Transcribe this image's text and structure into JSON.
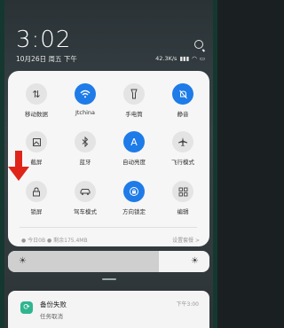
{
  "status_bar": {
    "time": "3:02",
    "date": "10月26日 周五 下午",
    "net_speed": "42.3K/s",
    "battery_icon": "battery-icon"
  },
  "tiles": [
    {
      "label": "移动数据",
      "icon": "⇅",
      "active": false
    },
    {
      "label": "Jtchina",
      "icon": "wifi",
      "active": true
    },
    {
      "label": "手电筒",
      "icon": "flashlight",
      "active": false
    },
    {
      "label": "静音",
      "icon": "bell-off",
      "active": true
    },
    {
      "label": "截屏",
      "icon": "screenshot",
      "active": false
    },
    {
      "label": "蓝牙",
      "icon": "bluetooth",
      "active": false
    },
    {
      "label": "自动亮度",
      "icon": "A",
      "active": true
    },
    {
      "label": "飞行模式",
      "icon": "airplane",
      "active": false
    },
    {
      "label": "锁屏",
      "icon": "lock",
      "active": false
    },
    {
      "label": "驾车模式",
      "icon": "car",
      "active": false
    },
    {
      "label": "方向锁定",
      "icon": "rotation-lock",
      "active": true
    },
    {
      "label": "编辑",
      "icon": "grid",
      "active": false
    }
  ],
  "memory": {
    "left": "● 今日0B  ● 剩余175.4MB",
    "right": "设置套餐 >"
  },
  "brightness": {
    "level": 0.75
  },
  "notification": {
    "title": "备份失败",
    "subtitle": "任务取消",
    "time": "下午3:00"
  },
  "colors": {
    "accent": "#1e7be8",
    "arrow": "#e0241a"
  }
}
